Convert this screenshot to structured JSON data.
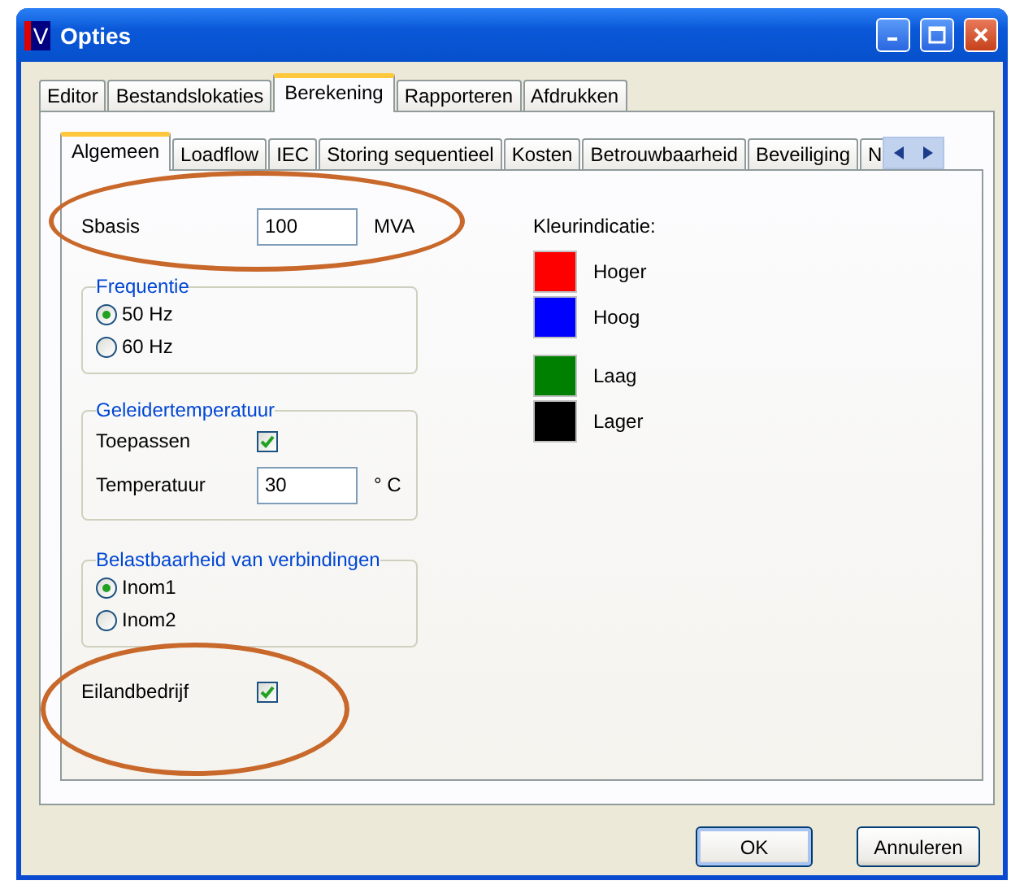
{
  "window": {
    "title": "Opties",
    "icon_text": "V"
  },
  "tabs": [
    {
      "label": "Editor",
      "selected": false
    },
    {
      "label": "Bestandslokaties",
      "selected": false
    },
    {
      "label": "Berekening",
      "selected": true
    },
    {
      "label": "Rapporteren",
      "selected": false
    },
    {
      "label": "Afdrukken",
      "selected": false
    }
  ],
  "subtabs": [
    {
      "label": "Algemeen",
      "selected": true
    },
    {
      "label": "Loadflow",
      "selected": false
    },
    {
      "label": "IEC",
      "selected": false
    },
    {
      "label": "Storing sequentieel",
      "selected": false
    },
    {
      "label": "Kosten",
      "selected": false
    },
    {
      "label": "Betrouwbaarheid",
      "selected": false
    },
    {
      "label": "Beveiliging",
      "selected": false
    },
    {
      "label": "N",
      "selected": false
    }
  ],
  "sbasis": {
    "label": "Sbasis",
    "value": "100",
    "unit": "MVA"
  },
  "frequentie": {
    "title": "Frequentie",
    "options": [
      {
        "label": "50 Hz",
        "selected": true
      },
      {
        "label": "60 Hz",
        "selected": false
      }
    ]
  },
  "geleidertemperatuur": {
    "title": "Geleidertemperatuur",
    "toepassen": {
      "label": "Toepassen",
      "checked": true
    },
    "temperatuur": {
      "label": "Temperatuur",
      "value": "30",
      "unit": "° C"
    }
  },
  "belastbaarheid": {
    "title": "Belastbaarheid van verbindingen",
    "options": [
      {
        "label": "Inom1",
        "selected": true
      },
      {
        "label": "Inom2",
        "selected": false
      }
    ]
  },
  "eilandbedrijf": {
    "label": "Eilandbedrijf",
    "checked": true
  },
  "kleurindicatie": {
    "title": "Kleurindicatie:",
    "groups": [
      [
        {
          "label": "Hoger",
          "color": "#ff0000"
        },
        {
          "label": "Hoog",
          "color": "#0000ff"
        }
      ],
      [
        {
          "label": "Laag",
          "color": "#008000"
        },
        {
          "label": "Lager",
          "color": "#000000"
        }
      ]
    ]
  },
  "buttons": [
    {
      "label": "OK",
      "default": true
    },
    {
      "label": "Annuleren",
      "default": false
    }
  ]
}
